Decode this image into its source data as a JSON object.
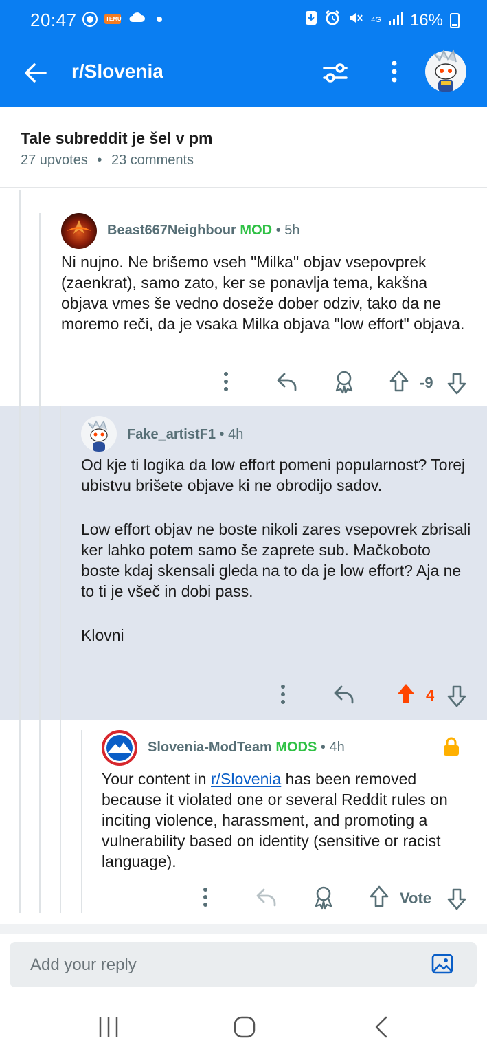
{
  "status_bar": {
    "time": "20:47",
    "battery": "16%",
    "network": "4G"
  },
  "header": {
    "subreddit": "r/Slovenia"
  },
  "post": {
    "title": "Tale subreddit je šel v pm",
    "upvotes": "27 upvotes",
    "sep": "•",
    "comments": "23 comments"
  },
  "comments": [
    {
      "user": "Beast667Neighbour",
      "badge": "MOD",
      "age": "5h",
      "paragraphs": [
        "Ni nujno. Ne brišemo vseh \"Milka\" objav vsepovprek (zaenkrat), samo zato, ker se ponavlja tema, kakšna objava vmes še vedno doseže dober odziv, tako da ne moremo reči, da je vsaka Milka objava \"low effort\" objava."
      ],
      "score": "-9"
    },
    {
      "user": "Fake_artistF1",
      "badge": "",
      "age": "4h",
      "paragraphs": [
        "Od kje ti logika da low effort pomeni popularnost? Torej ubistvu brišete objave ki ne obrodijo sadov.",
        "Low effort objav ne boste nikoli zares vsepovrek zbrisali ker lahko potem samo še zaprete sub. Mačkoboto boste kdaj skensali gleda na to da je low effort? Aja ne to ti je všeč in dobi pass.",
        "Klovni"
      ],
      "score": "4",
      "upvoted": true
    },
    {
      "user": "Slovenia-ModTeam",
      "badge": "MODS",
      "age": "4h",
      "text_before_link": "Your content in ",
      "link": "r/Slovenia",
      "text_after_link": " has been removed because it violated one or several Reddit rules on inciting violence, harassment, and promoting a vulnerability based on identity (sensitive or racist language).",
      "score": "Vote"
    }
  ],
  "reply": {
    "placeholder": "Add your reply"
  },
  "colors": {
    "brand_blue": "#0a7ef2",
    "mod_green": "#2fc145",
    "upvote_orange": "#ff4500",
    "highlight": "#e0e5ee"
  }
}
